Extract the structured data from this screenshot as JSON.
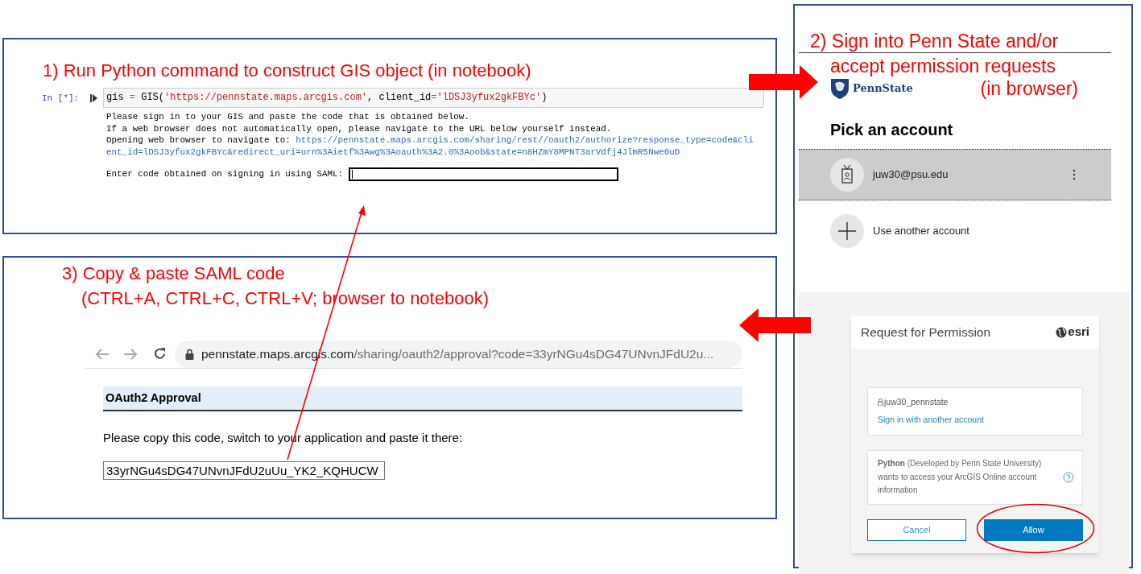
{
  "notebook": {
    "caption": "1) Run Python command to construct GIS object (in notebook)",
    "cell": {
      "prompt": "In [*]:",
      "code": [
        {
          "kind": "name",
          "text": "gis "
        },
        {
          "kind": "operator",
          "text": "="
        },
        {
          "kind": "name",
          "text": " GIS("
        },
        {
          "kind": "string",
          "text": "'https://pennstate.maps.arcgis.com'"
        },
        {
          "kind": "name",
          "text": ", client_id"
        },
        {
          "kind": "operator",
          "text": "="
        },
        {
          "kind": "string",
          "text": "'lDSJ3yfux2gkFBYc'"
        },
        {
          "kind": "name",
          "text": ")"
        }
      ],
      "output_lines": [
        "Please sign in to your GIS and paste the code that is obtained below.",
        "If a web browser does not automatically open, please navigate to the URL below yourself instead."
      ],
      "open_label": "Opening web browser to navigate to: ",
      "open_url": "https://pennstate.maps.arcgis.com/sharing/rest//oauth2/authorize?response_type=code&client_id=lDSJ3yfux2gkFBYc&redirect_uri=urn%3Aietf%3Awg%3Aoauth%3A2.0%3Aoob&state=n8HZmY8MPNT3arVdfj4JlmR5Nwe0uD",
      "code_prompt": "Enter code obtained on signing in using SAML:",
      "code_field": {
        "focused": true
      }
    }
  },
  "browser": {
    "caption_lines": [
      "2) Sign into Penn State and/or",
      "accept permission requests",
      "(in browser)"
    ],
    "logo_text": "PennState",
    "heading": "Pick an account",
    "accounts": [
      {
        "kind": "account",
        "label": "juw30@psu.edu",
        "selected": true
      },
      {
        "kind": "add",
        "label": "Use another account",
        "selected": false
      }
    ],
    "permission": {
      "title": "Request for Permission",
      "brand": "esri",
      "username": "juw30_pennstate",
      "switch_link": "Sign in with another account",
      "message": "**Python** (Developed by Penn State University) wants to access your ArcGIS Online account information",
      "buttons": [
        {
          "kind": "secondary",
          "label": "Cancel",
          "highlighted": false
        },
        {
          "kind": "primary",
          "label": "Allow",
          "highlighted": true
        }
      ]
    }
  },
  "approval": {
    "caption_lines": [
      "3) Copy & paste SAML code",
      "(CTRL+A, CTRL+C, CTRL+V; browser to notebook)"
    ],
    "url_host": "pennstate.maps.arcgis.com",
    "url_path": "/sharing/oauth2/approval?code=33yrNGu4sDG47UNvnJFdU2u...",
    "heading": "OAuth2 Approval",
    "instruction": "Please copy this code, switch to your application and paste it there:",
    "code_value": "33yrNGu4sDG47UNvnJFdU2uUu_YK2_KQHUCW"
  }
}
